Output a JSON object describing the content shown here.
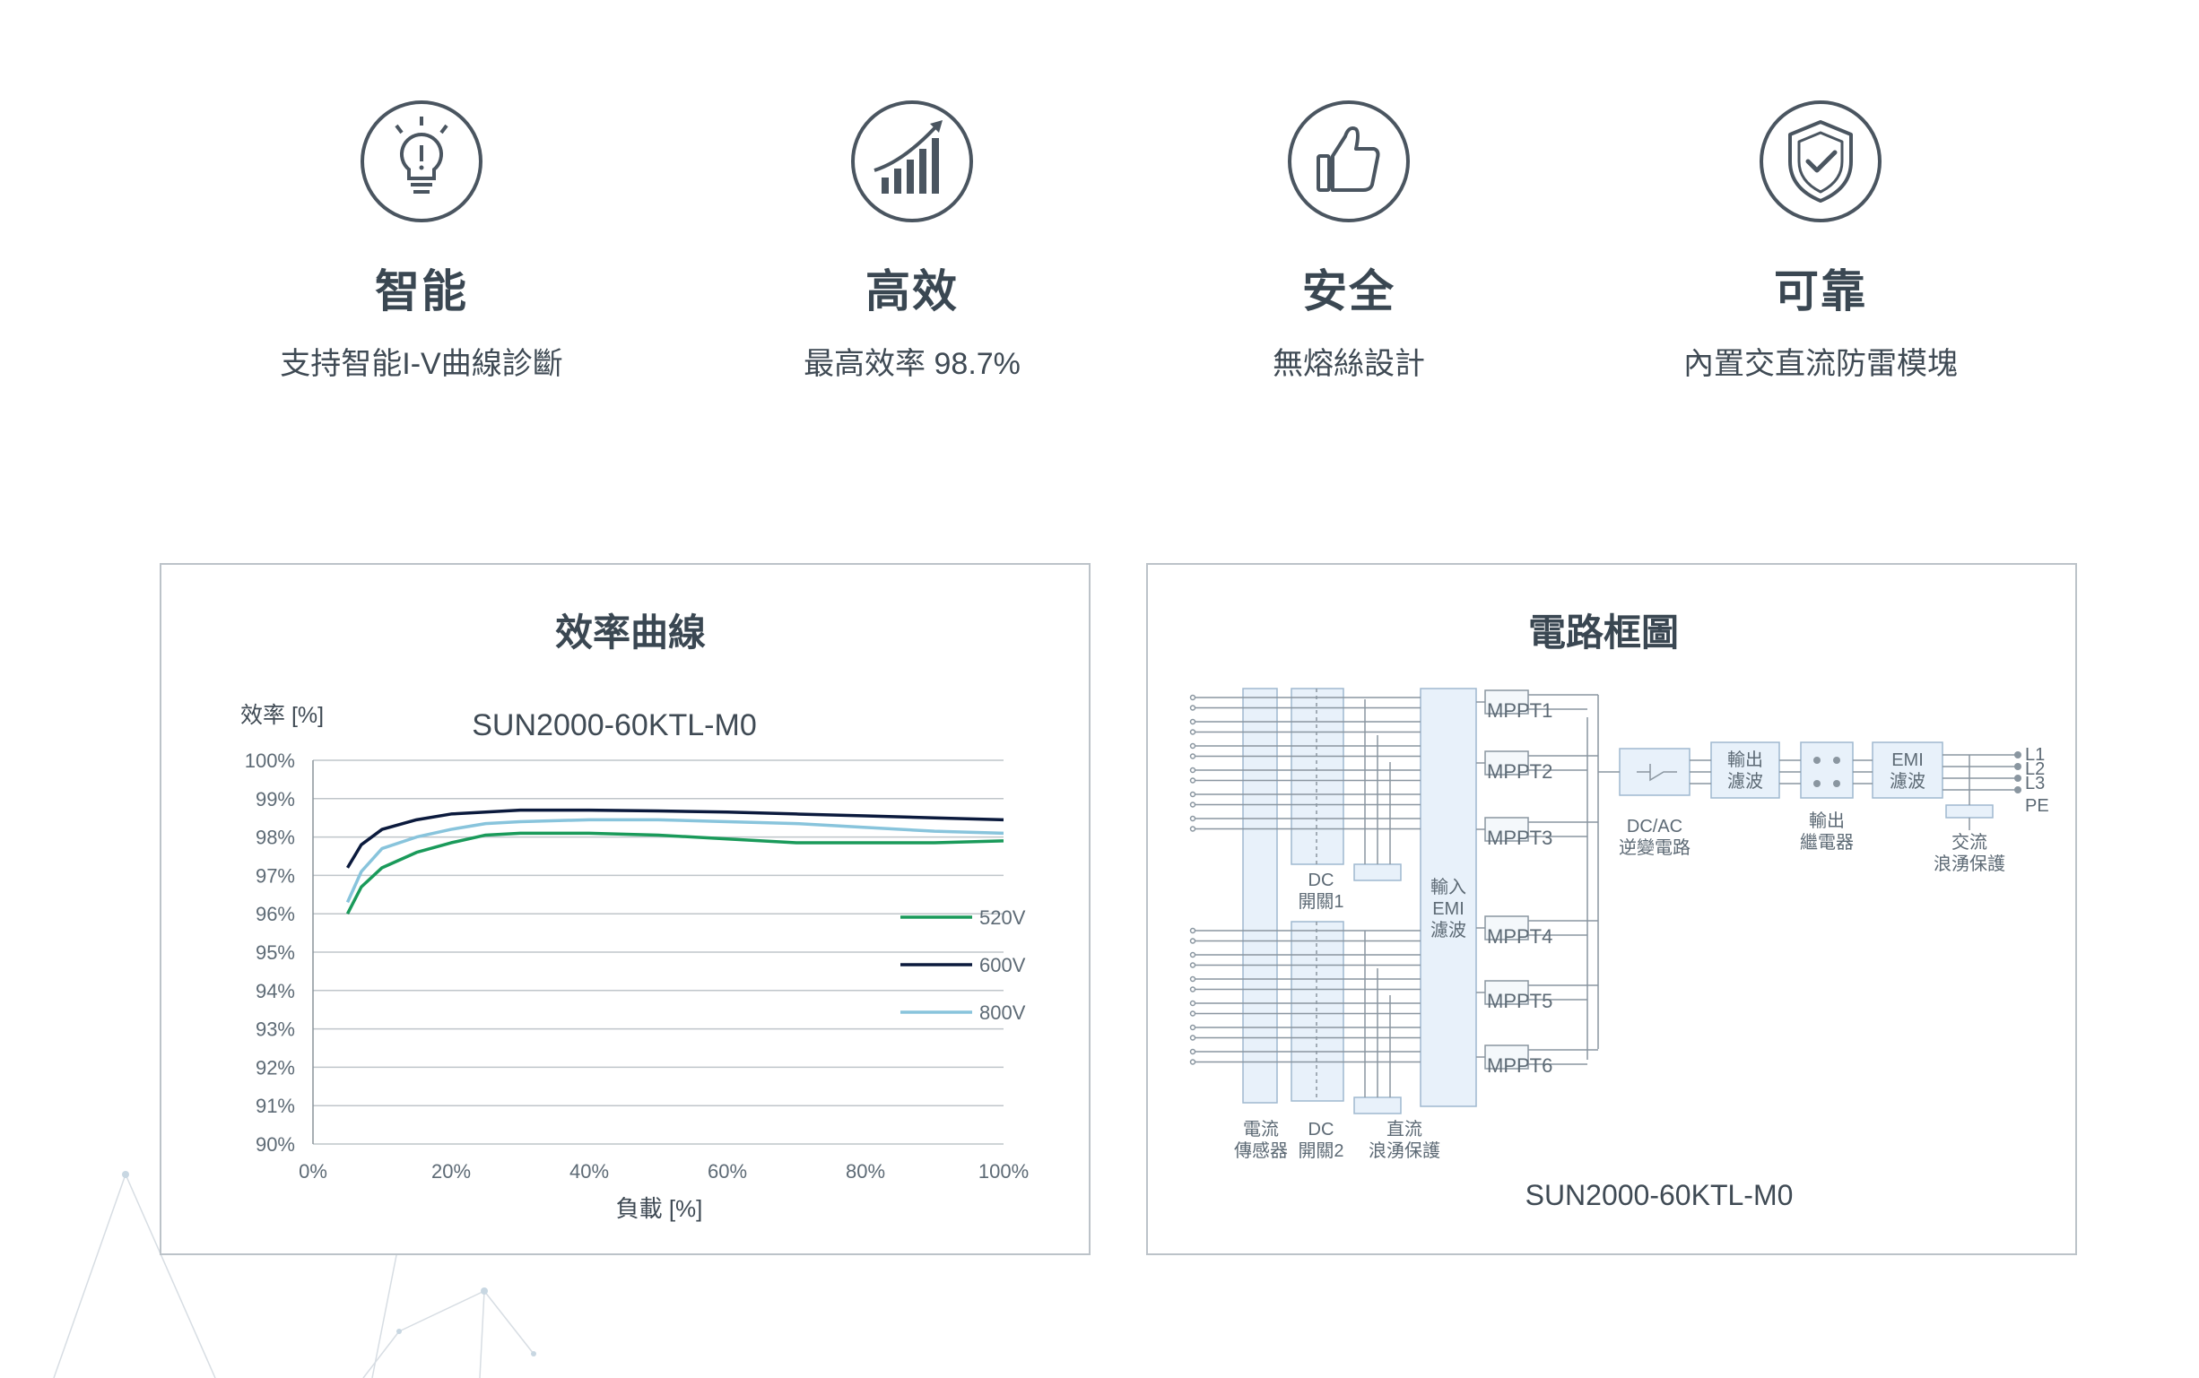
{
  "features": [
    {
      "title": "智能",
      "desc": "支持智能I-V曲線診斷",
      "icon": "lightbulb-icon"
    },
    {
      "title": "高效",
      "desc": "最高效率 98.7%",
      "icon": "growth-chart-icon"
    },
    {
      "title": "安全",
      "desc": "無熔絲設計",
      "icon": "thumbs-up-icon"
    },
    {
      "title": "可靠",
      "desc": "內置交直流防雷模塊",
      "icon": "shield-check-icon"
    }
  ],
  "efficiency_panel": {
    "heading": "效率曲線",
    "chart_data": {
      "type": "line",
      "title": "SUN2000-60KTL-M0",
      "ylabel": "效率 [%]",
      "xlabel": "負載 [%]",
      "xlim": [
        0,
        100
      ],
      "ylim": [
        90,
        100
      ],
      "x_ticks": [
        "0%",
        "20%",
        "40%",
        "60%",
        "80%",
        "100%"
      ],
      "y_ticks": [
        "90%",
        "91%",
        "92%",
        "93%",
        "94%",
        "95%",
        "96%",
        "97%",
        "98%",
        "99%",
        "100%"
      ],
      "grid": true,
      "legend": "right",
      "series": [
        {
          "name": "520V",
          "color": "#1a9a5a",
          "x": [
            5,
            7,
            10,
            15,
            20,
            25,
            30,
            40,
            50,
            60,
            70,
            80,
            90,
            100
          ],
          "y": [
            96.0,
            96.7,
            97.2,
            97.6,
            97.85,
            98.05,
            98.1,
            98.1,
            98.05,
            97.95,
            97.85,
            97.85,
            97.85,
            97.9
          ]
        },
        {
          "name": "600V",
          "color": "#0b1a3d",
          "x": [
            5,
            7,
            10,
            15,
            20,
            25,
            30,
            40,
            50,
            60,
            70,
            80,
            90,
            100
          ],
          "y": [
            97.2,
            97.8,
            98.2,
            98.45,
            98.6,
            98.65,
            98.7,
            98.7,
            98.68,
            98.65,
            98.6,
            98.55,
            98.5,
            98.45
          ]
        },
        {
          "name": "800V",
          "color": "#88c4dc",
          "x": [
            5,
            7,
            10,
            15,
            20,
            25,
            30,
            40,
            50,
            60,
            70,
            80,
            90,
            100
          ],
          "y": [
            96.3,
            97.1,
            97.7,
            98.0,
            98.2,
            98.35,
            98.4,
            98.45,
            98.45,
            98.4,
            98.35,
            98.25,
            98.15,
            98.1
          ]
        }
      ]
    }
  },
  "circuit_panel": {
    "heading": "電路框圖",
    "model": "SUN2000-60KTL-M0",
    "labels": {
      "mppt": [
        "MPPT1",
        "MPPT2",
        "MPPT3",
        "MPPT4",
        "MPPT5",
        "MPPT6"
      ],
      "dc_switch1": [
        "DC",
        "開關1"
      ],
      "dc_switch2": [
        "DC",
        "開關2"
      ],
      "current_sensor": [
        "電流",
        "傳感器"
      ],
      "dc_surge": [
        "直流",
        "浪湧保護"
      ],
      "input_emi": [
        "輸入",
        "EMI",
        "濾波"
      ],
      "dcac": [
        "DC/AC",
        "逆變電路"
      ],
      "output_filter": [
        "輸出",
        "濾波"
      ],
      "output_relay": [
        "輸出",
        "繼電器"
      ],
      "emi_filter": [
        "EMI",
        "濾波"
      ],
      "ac_surge": [
        "交流",
        "浪湧保護"
      ],
      "phases": [
        "L1",
        "L2",
        "L3",
        "PE"
      ]
    }
  }
}
